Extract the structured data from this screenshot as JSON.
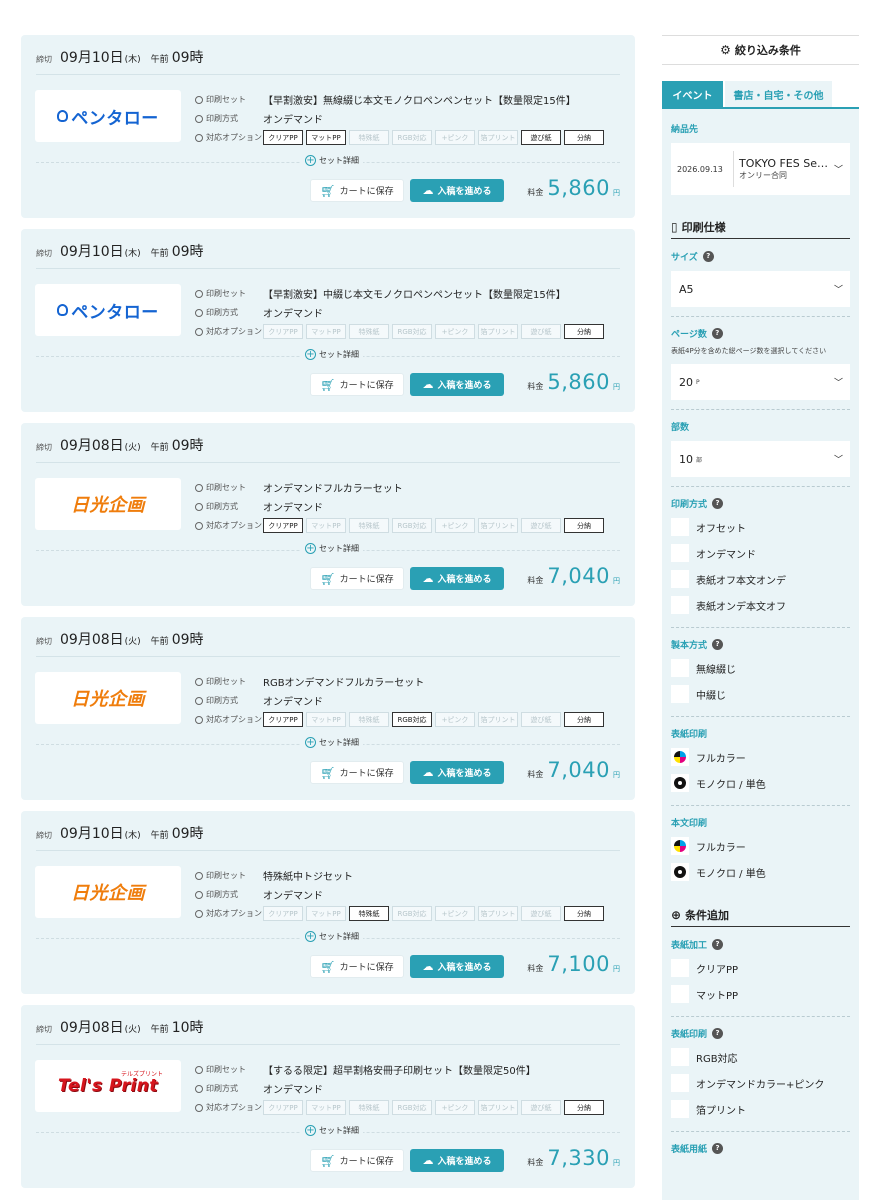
{
  "cards": [
    {
      "deadline": "締切",
      "date": "09月10日",
      "dow": "(木)",
      "ampm": "午前",
      "hour": "09時",
      "logo": "ペンタロー",
      "logo_type": "pentaro",
      "set_label": "印刷セット",
      "set_value": "【早割激安】無線綴じ本文モノクロペンペンセット【数量限定15件】",
      "method_label": "印刷方式",
      "method_value": "オンデマンド",
      "options_label": "対応オプション",
      "options": [
        {
          "label": "クリアPP",
          "on": true
        },
        {
          "label": "マットPP",
          "on": true
        },
        {
          "label": "特殊紙",
          "on": false
        },
        {
          "label": "RGB対応",
          "on": false
        },
        {
          "label": "+ピンク",
          "on": false
        },
        {
          "label": "箔プリント",
          "on": false
        },
        {
          "label": "遊び紙",
          "on": true
        },
        {
          "label": "分納",
          "on": true
        }
      ],
      "detail": "セット詳細",
      "cart": "カートに保存",
      "submit": "入稿を進める",
      "price_label": "料金",
      "price": "5,860",
      "price_unit": "円"
    },
    {
      "deadline": "締切",
      "date": "09月10日",
      "dow": "(木)",
      "ampm": "午前",
      "hour": "09時",
      "logo": "ペンタロー",
      "logo_type": "pentaro",
      "set_label": "印刷セット",
      "set_value": "【早割激安】中綴じ本文モノクロペンペンセット【数量限定15件】",
      "method_label": "印刷方式",
      "method_value": "オンデマンド",
      "options_label": "対応オプション",
      "options": [
        {
          "label": "クリアPP",
          "on": false
        },
        {
          "label": "マットPP",
          "on": false
        },
        {
          "label": "特殊紙",
          "on": false
        },
        {
          "label": "RGB対応",
          "on": false
        },
        {
          "label": "+ピンク",
          "on": false
        },
        {
          "label": "箔プリント",
          "on": false
        },
        {
          "label": "遊び紙",
          "on": false
        },
        {
          "label": "分納",
          "on": true
        }
      ],
      "detail": "セット詳細",
      "cart": "カートに保存",
      "submit": "入稿を進める",
      "price_label": "料金",
      "price": "5,860",
      "price_unit": "円"
    },
    {
      "deadline": "締切",
      "date": "09月08日",
      "dow": "(火)",
      "ampm": "午前",
      "hour": "09時",
      "logo": "日光企画",
      "logo_type": "nikko",
      "set_label": "印刷セット",
      "set_value": "オンデマンドフルカラーセット",
      "method_label": "印刷方式",
      "method_value": "オンデマンド",
      "options_label": "対応オプション",
      "options": [
        {
          "label": "クリアPP",
          "on": true
        },
        {
          "label": "マットPP",
          "on": false
        },
        {
          "label": "特殊紙",
          "on": false
        },
        {
          "label": "RGB対応",
          "on": false
        },
        {
          "label": "+ピンク",
          "on": false
        },
        {
          "label": "箔プリント",
          "on": false
        },
        {
          "label": "遊び紙",
          "on": false
        },
        {
          "label": "分納",
          "on": true
        }
      ],
      "detail": "セット詳細",
      "cart": "カートに保存",
      "submit": "入稿を進める",
      "price_label": "料金",
      "price": "7,040",
      "price_unit": "円"
    },
    {
      "deadline": "締切",
      "date": "09月08日",
      "dow": "(火)",
      "ampm": "午前",
      "hour": "09時",
      "logo": "日光企画",
      "logo_type": "nikko",
      "set_label": "印刷セット",
      "set_value": "RGBオンデマンドフルカラーセット",
      "method_label": "印刷方式",
      "method_value": "オンデマンド",
      "options_label": "対応オプション",
      "options": [
        {
          "label": "クリアPP",
          "on": true
        },
        {
          "label": "マットPP",
          "on": false
        },
        {
          "label": "特殊紙",
          "on": false
        },
        {
          "label": "RGB対応",
          "on": true
        },
        {
          "label": "+ピンク",
          "on": false
        },
        {
          "label": "箔プリント",
          "on": false
        },
        {
          "label": "遊び紙",
          "on": false
        },
        {
          "label": "分納",
          "on": true
        }
      ],
      "detail": "セット詳細",
      "cart": "カートに保存",
      "submit": "入稿を進める",
      "price_label": "料金",
      "price": "7,040",
      "price_unit": "円"
    },
    {
      "deadline": "締切",
      "date": "09月10日",
      "dow": "(木)",
      "ampm": "午前",
      "hour": "09時",
      "logo": "日光企画",
      "logo_type": "nikko",
      "set_label": "印刷セット",
      "set_value": "特殊紙中トジセット",
      "method_label": "印刷方式",
      "method_value": "オンデマンド",
      "options_label": "対応オプション",
      "options": [
        {
          "label": "クリアPP",
          "on": false
        },
        {
          "label": "マットPP",
          "on": false
        },
        {
          "label": "特殊紙",
          "on": true
        },
        {
          "label": "RGB対応",
          "on": false
        },
        {
          "label": "+ピンク",
          "on": false
        },
        {
          "label": "箔プリント",
          "on": false
        },
        {
          "label": "遊び紙",
          "on": false
        },
        {
          "label": "分納",
          "on": true
        }
      ],
      "detail": "セット詳細",
      "cart": "カートに保存",
      "submit": "入稿を進める",
      "price_label": "料金",
      "price": "7,100",
      "price_unit": "円"
    },
    {
      "deadline": "締切",
      "date": "09月08日",
      "dow": "(火)",
      "ampm": "午前",
      "hour": "10時",
      "logo": "Tel's Print",
      "logo_sub": "テルズプリント",
      "logo_type": "tels",
      "set_label": "印刷セット",
      "set_value": "【するる限定】超早割格安冊子印刷セット【数量限定50件】",
      "method_label": "印刷方式",
      "method_value": "オンデマンド",
      "options_label": "対応オプション",
      "options": [
        {
          "label": "クリアPP",
          "on": false
        },
        {
          "label": "マットPP",
          "on": false
        },
        {
          "label": "特殊紙",
          "on": false
        },
        {
          "label": "RGB対応",
          "on": false
        },
        {
          "label": "+ピンク",
          "on": false
        },
        {
          "label": "箔プリント",
          "on": false
        },
        {
          "label": "遊び紙",
          "on": false
        },
        {
          "label": "分納",
          "on": true
        }
      ],
      "detail": "セット詳細",
      "cart": "カートに保存",
      "submit": "入稿を進める",
      "price_label": "料金",
      "price": "7,330",
      "price_unit": "円"
    }
  ],
  "sidebar": {
    "title": "絞り込み条件",
    "tabs": [
      "イベント",
      "書店・自宅・その他"
    ],
    "dest_label": "納品先",
    "dest_date": "2026.09.13",
    "dest_name": "TOKYO FES Se…",
    "dest_sub": "オンリー合同",
    "print_spec_title": "印刷仕様",
    "size_label": "サイズ",
    "size_value": "A5",
    "pages_label": "ページ数",
    "pages_note": "表紙4P分を含めた総ページ数を選択してください",
    "pages_value": "20",
    "pages_unit": "P",
    "copies_label": "部数",
    "copies_value": "10",
    "copies_unit": "部",
    "method_label": "印刷方式",
    "methods": [
      "オフセット",
      "オンデマンド",
      "表紙オフ本文オンデ",
      "表紙オンデ本文オフ"
    ],
    "binding_label": "製本方式",
    "bindings": [
      "無線綴じ",
      "中綴じ"
    ],
    "cover_print_label": "表紙印刷",
    "cover_prints": [
      "フルカラー",
      "モノクロ / 単色"
    ],
    "body_print_label": "本文印刷",
    "body_prints": [
      "フルカラー",
      "モノクロ / 単色"
    ],
    "add_title": "条件追加",
    "cover_finish_label": "表紙加工",
    "cover_finishes": [
      "クリアPP",
      "マットPP"
    ],
    "cover_print2_label": "表紙印刷",
    "cover_print2": [
      "RGB対応",
      "オンデマンドカラー+ピンク",
      "箔プリント"
    ],
    "cover_paper_label": "表紙用紙"
  }
}
